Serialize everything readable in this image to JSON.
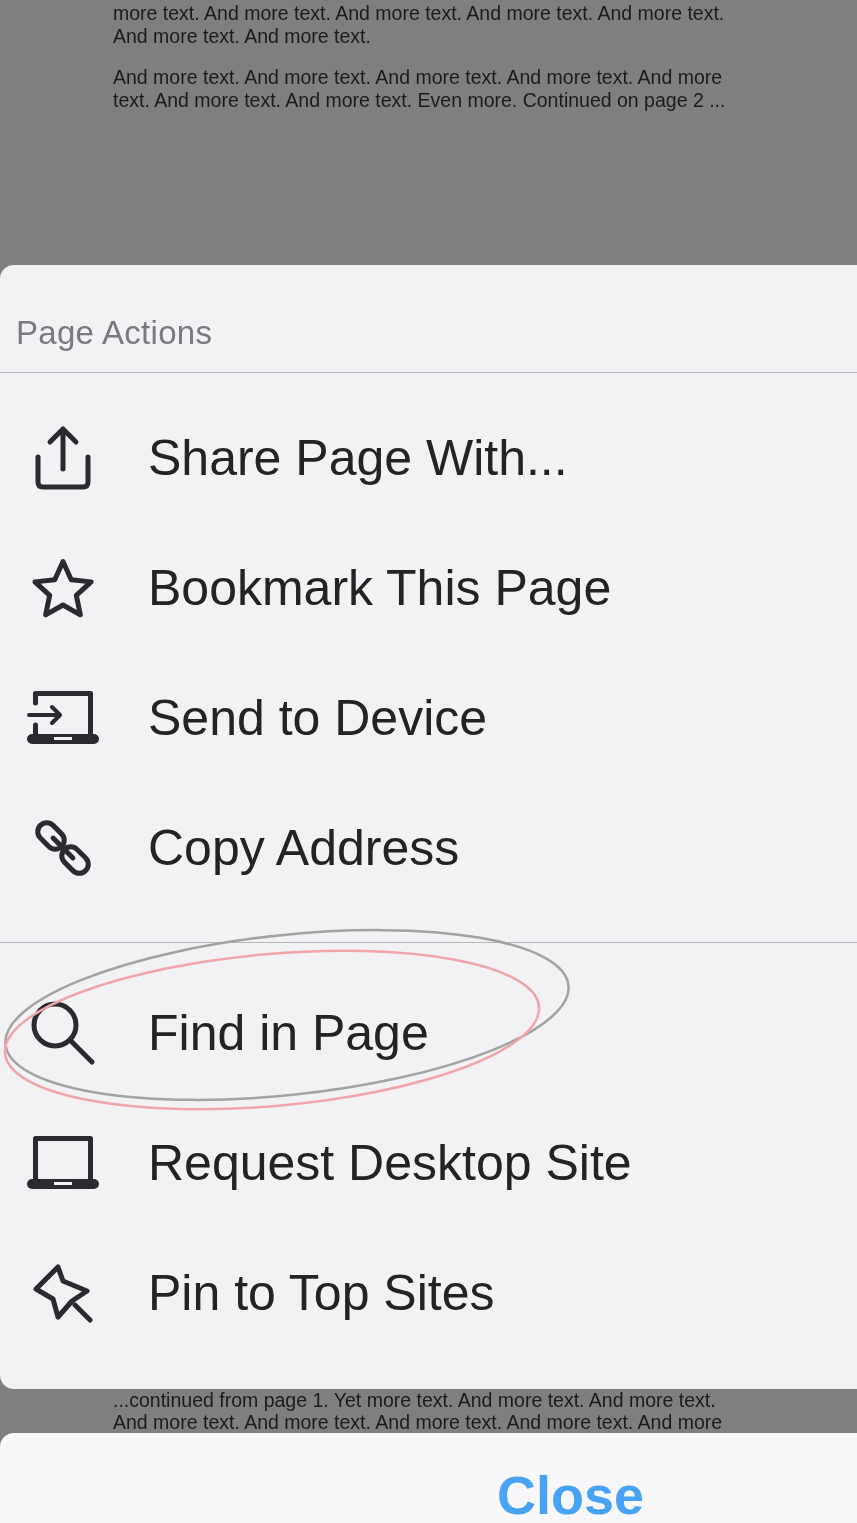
{
  "background_page": {
    "top_paragraphs": [
      "more text. And more text. And more text. And more text. And more text. And more text. And more text.",
      "And more text. And more text. And more text. And more text. And more text. And more text. And more text. Even more. Continued on page 2 ..."
    ],
    "bottom_paragraphs": [
      "...continued from page 1. Yet more text. And more text. And more text. And more text. And more text. And more text. And more text. And more"
    ]
  },
  "action_sheet": {
    "header": "Page Actions",
    "sections": [
      {
        "items": [
          {
            "label": "Share Page With...",
            "circled": false
          },
          {
            "label": "Bookmark This Page",
            "circled": false
          },
          {
            "label": "Send to Device",
            "circled": false
          },
          {
            "label": "Copy Address",
            "circled": false
          }
        ]
      },
      {
        "items": [
          {
            "label": "Find in Page",
            "circled": true
          },
          {
            "label": "Request Desktop Site",
            "circled": false
          },
          {
            "label": "Pin to Top Sites",
            "circled": false
          }
        ]
      }
    ]
  },
  "close_button": {
    "label": "Close"
  }
}
